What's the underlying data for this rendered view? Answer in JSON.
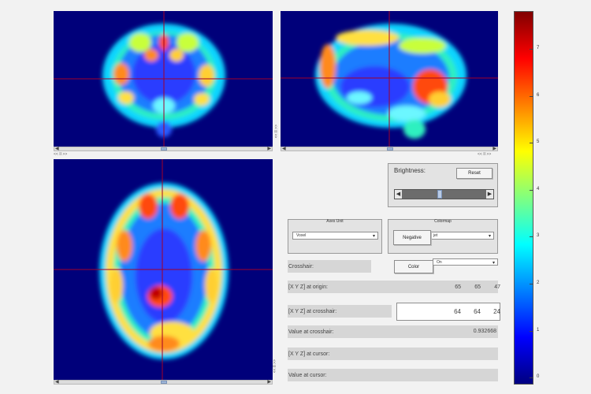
{
  "views": {
    "coronal": {
      "below_label": "<< II >>"
    },
    "sagittal": {
      "side_label": "<< II >>",
      "below_label": "<< II >>"
    },
    "axial": {
      "side_label": "<< II >>"
    }
  },
  "brightness": {
    "label": "Brightness:",
    "reset_label": "Reset",
    "level": 0.45
  },
  "axes_unit": {
    "title": "Axes Unit",
    "selected": "Voxel"
  },
  "colormap": {
    "title": "Colormap",
    "negative_label": "Negative",
    "selected": "jet"
  },
  "crosshair": {
    "label": "Crosshair:",
    "color_label": "Color",
    "selected": "On"
  },
  "origin": {
    "label": "[X Y Z] at origin:",
    "x": "65",
    "y": "65",
    "z": "47"
  },
  "at_crosshair": {
    "label": "[X Y Z] at crosshair:",
    "x": "64",
    "y": "64",
    "z": "24"
  },
  "value_crosshair": {
    "label": "Value at crosshair:",
    "value": "0.932668"
  },
  "at_cursor": {
    "label": "[X Y Z] at cursor:"
  },
  "value_cursor": {
    "label": "Value at cursor:"
  },
  "colorbar": {
    "ticks": [
      "7",
      "6",
      "5",
      "4",
      "3",
      "2",
      "1",
      "0"
    ]
  }
}
